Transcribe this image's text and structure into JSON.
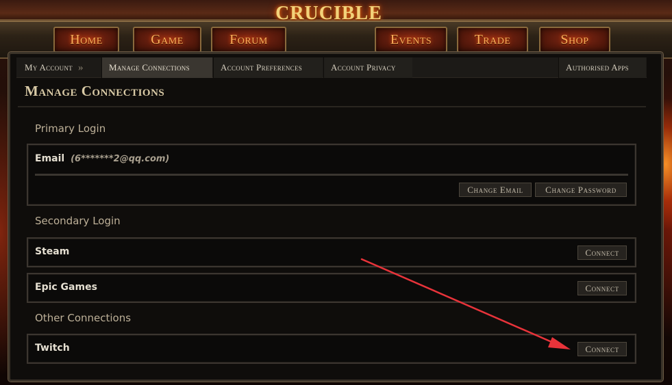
{
  "header": {
    "logo_text": "CRUCIBLE"
  },
  "nav": {
    "home": "Home",
    "game": "Game",
    "forum": "Forum",
    "events": "Events",
    "trade": "Trade",
    "shop": "Shop"
  },
  "subnav": {
    "my_account": "My Account",
    "separator": "»",
    "manage_connections": "Manage Connections",
    "account_preferences": "Account Preferences",
    "account_privacy": "Account Privacy",
    "authorised_apps": "Authorised Apps"
  },
  "page": {
    "title": "Manage Connections"
  },
  "primary_login": {
    "heading": "Primary Login",
    "email_label": "Email",
    "email_value": "(6*******2@qq.com)",
    "change_email": "Change Email",
    "change_password": "Change Password"
  },
  "secondary_login": {
    "heading": "Secondary Login",
    "items": [
      {
        "label": "Steam",
        "button": "Connect"
      },
      {
        "label": "Epic Games",
        "button": "Connect"
      }
    ]
  },
  "other_connections": {
    "heading": "Other Connections",
    "items": [
      {
        "label": "Twitch",
        "button": "Connect"
      }
    ]
  },
  "colors": {
    "annotation_arrow": "#e8333a",
    "nav_text": "#ffb05a",
    "panel_bg": "#0f0d0b"
  }
}
